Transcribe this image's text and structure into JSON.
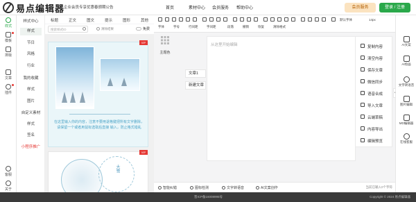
{
  "header": {
    "logo_text": "易点编辑器",
    "notice": "企业会员专享优惠春颁期公告",
    "nav": [
      "首页",
      "素材中心",
      "会员服务",
      "帮助中心"
    ],
    "vip_label": "会员服务",
    "login_label": "登录 / 注册"
  },
  "leftbar": {
    "items": [
      {
        "label": "样式",
        "icon": "palette-icon"
      },
      {
        "label": "模板",
        "icon": "template-icon"
      },
      {
        "label": "排版",
        "icon": "layout-icon"
      },
      {
        "label": "文章",
        "icon": "article-icon"
      },
      {
        "label": "插件",
        "icon": "plugin-icon"
      }
    ],
    "bottom": [
      {
        "label": "客服",
        "icon": "support-icon"
      },
      {
        "label": "关于",
        "icon": "info-icon"
      }
    ]
  },
  "categories": {
    "items": [
      "样式中心",
      "样式",
      "节日",
      "风格",
      "行业",
      "我的收藏",
      "样式",
      "图片",
      "自定义素材",
      "样式",
      "签名",
      "小程序推广"
    ],
    "selected": "样式"
  },
  "style_tabs": [
    "标题",
    "正文",
    "图文",
    "提示",
    "图形",
    "其他"
  ],
  "search": {
    "placeholder": "搜索样式ID",
    "clear_label": "清除结果",
    "free_label": "免费"
  },
  "styles_list": {
    "badge": "VIP",
    "card1_text": "在这里输入你的内容，注意不要用退格键把所有文字删除，请保留一个或者用鼠标选取后直接 输入，防止格式错乱",
    "card2_vertical": "大雪"
  },
  "toolbar": {
    "row1": [
      "字体",
      "字号",
      "行间距",
      "字间距",
      "默认字体",
      "14px"
    ],
    "row2": [
      "段落",
      "撤销",
      "恢复",
      "清除格式"
    ]
  },
  "editor": {
    "theme_label": "主题色",
    "doc_tabs": [
      "文章1",
      "新建文章"
    ],
    "placeholder": "从这里开始编辑"
  },
  "actions": [
    "复制内容",
    "清空内容",
    "保存文章",
    "微信同步",
    "语音合成",
    "导入文章",
    "云端草稿",
    "内容导出",
    "编辑预览"
  ],
  "ai_panel": [
    "AI文案",
    "AI绘画",
    "文字转语音",
    "图片编辑",
    "MD编辑器",
    "在线客服"
  ],
  "statusbar": {
    "items": [
      "智能纠错",
      "图标检测",
      "文字转语音",
      "AI文案创作"
    ],
    "count": "当前已输入0个字符"
  },
  "footer": {
    "icp": "晋ICP备16008995号",
    "copyright": "Copyright © 2024 易点编辑器"
  }
}
